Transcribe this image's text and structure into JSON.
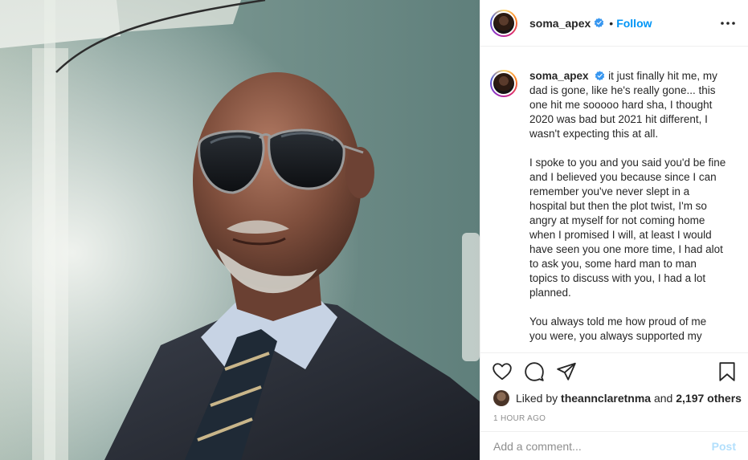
{
  "post": {
    "username": "soma_apex",
    "verified": true,
    "separator": "•",
    "follow_label": "Follow",
    "more_icon": "more-options-icon"
  },
  "caption": {
    "username": "soma_apex",
    "paragraphs": [
      "it just finally hit me, my dad is gone, like he's really gone... this one hit me sooooo hard sha, I thought 2020 was bad but 2021 hit different, I wasn't expecting this at all.",
      "I spoke to you and you said you'd be fine and I believed you because since I can remember you've never slept in a hospital but then the plot twist, I'm so angry at myself for not coming home when I promised I will, at least I would have seen you one more time, I had alot to ask you, some hard man to man topics to discuss with you, I had a lot planned.",
      "You always told me how proud of me you were, you always supported my"
    ]
  },
  "likes": {
    "prefix": "Liked by",
    "user": "theannclaretnma",
    "middle": "and",
    "others": "2,197 others"
  },
  "timestamp": "1 HOUR AGO",
  "comment": {
    "placeholder": "Add a comment...",
    "post_label": "Post"
  },
  "colors": {
    "accent": "#0095f6",
    "post_disabled": "#b2dffc",
    "muted": "#8e8e8e",
    "border": "#efefef"
  }
}
